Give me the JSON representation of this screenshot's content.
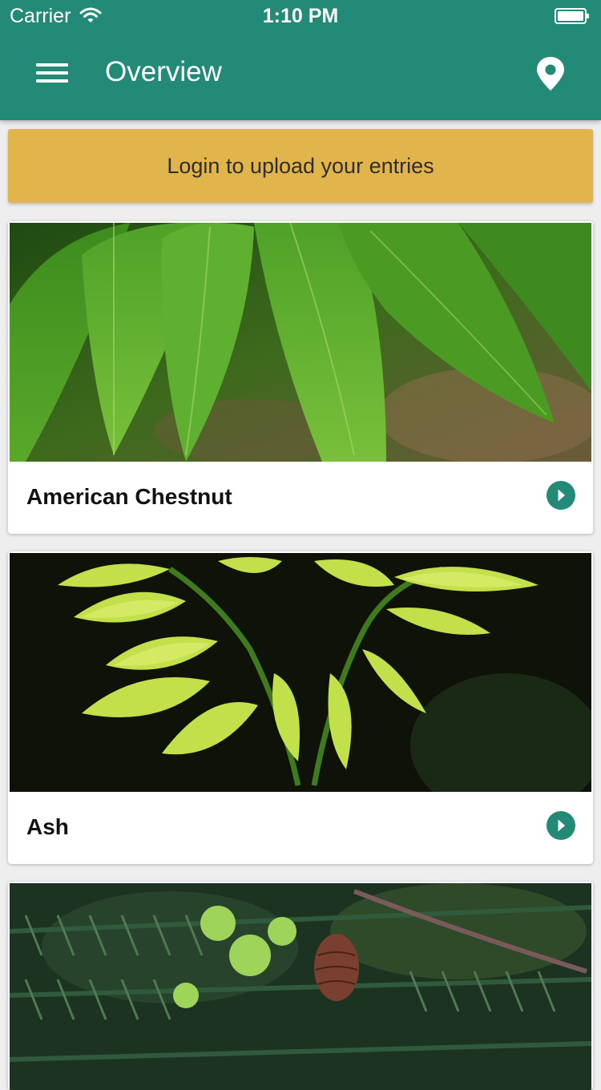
{
  "status_bar": {
    "carrier": "Carrier",
    "time": "1:10 PM",
    "wifi_icon": "wifi-icon",
    "battery_icon": "battery-icon"
  },
  "header": {
    "title": "Overview",
    "menu_icon": "hamburger-menu-icon",
    "map_icon": "map-marker-icon"
  },
  "banner": {
    "text": "Login to upload your entries"
  },
  "species": [
    {
      "name": "American Chestnut",
      "image": "chestnut-leaves-photo"
    },
    {
      "name": "Ash",
      "image": "ash-leaves-photo"
    },
    {
      "name": "",
      "image": "hemlock-branch-photo"
    }
  ],
  "colors": {
    "primary": "#238a78",
    "banner": "#e2b54c",
    "background": "#eeeeee",
    "card": "#ffffff",
    "title_text": "#ffffff"
  }
}
